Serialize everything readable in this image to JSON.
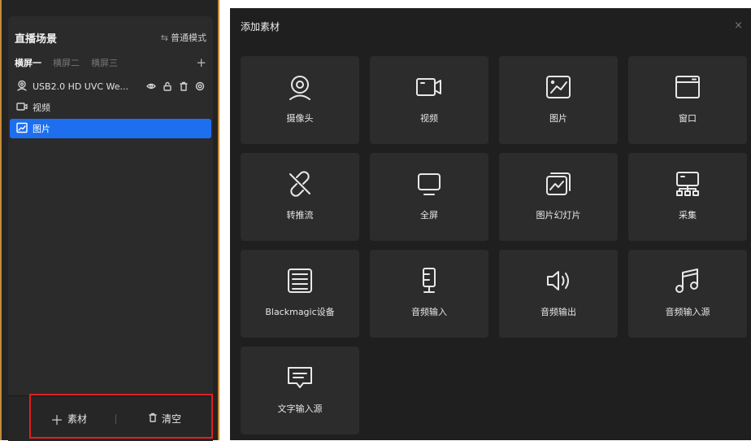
{
  "scene_panel": {
    "title": "直播场景",
    "mode_label": "普通模式",
    "mode_icon": "swap-icon",
    "tabs": [
      {
        "label": "横屏一",
        "active": true
      },
      {
        "label": "横屏二",
        "active": false
      },
      {
        "label": "横屏三",
        "active": false
      }
    ],
    "add_tab_label": "+",
    "sources": [
      {
        "label": "USB2.0 HD UVC We...",
        "icon": "webcam-icon",
        "selected": false
      },
      {
        "label": "视频",
        "icon": "video-icon",
        "selected": false
      },
      {
        "label": "图片",
        "icon": "image-icon",
        "selected": true
      }
    ],
    "add_material_label": "素材",
    "clear_label": "清空",
    "highlight_color": "#e02020",
    "selected_color": "#1e6ff0"
  },
  "dialog": {
    "title": "添加素材",
    "close_label": "×",
    "tiles": [
      {
        "label": "摄像头",
        "icon": "webcam-icon"
      },
      {
        "label": "视频",
        "icon": "video-camera-icon"
      },
      {
        "label": "图片",
        "icon": "image-icon"
      },
      {
        "label": "窗口",
        "icon": "window-icon"
      },
      {
        "label": "转推流",
        "icon": "link-broken-icon"
      },
      {
        "label": "全屏",
        "icon": "monitor-icon"
      },
      {
        "label": "图片幻灯片",
        "icon": "slideshow-icon"
      },
      {
        "label": "采集",
        "icon": "capture-icon"
      },
      {
        "label": "Blackmagic设备",
        "icon": "capture-card-icon"
      },
      {
        "label": "音频输入",
        "icon": "microphone-icon"
      },
      {
        "label": "音频输出",
        "icon": "speaker-icon"
      },
      {
        "label": "音频输入源",
        "icon": "music-note-icon"
      },
      {
        "label": "文字输入源",
        "icon": "text-message-icon"
      }
    ]
  }
}
